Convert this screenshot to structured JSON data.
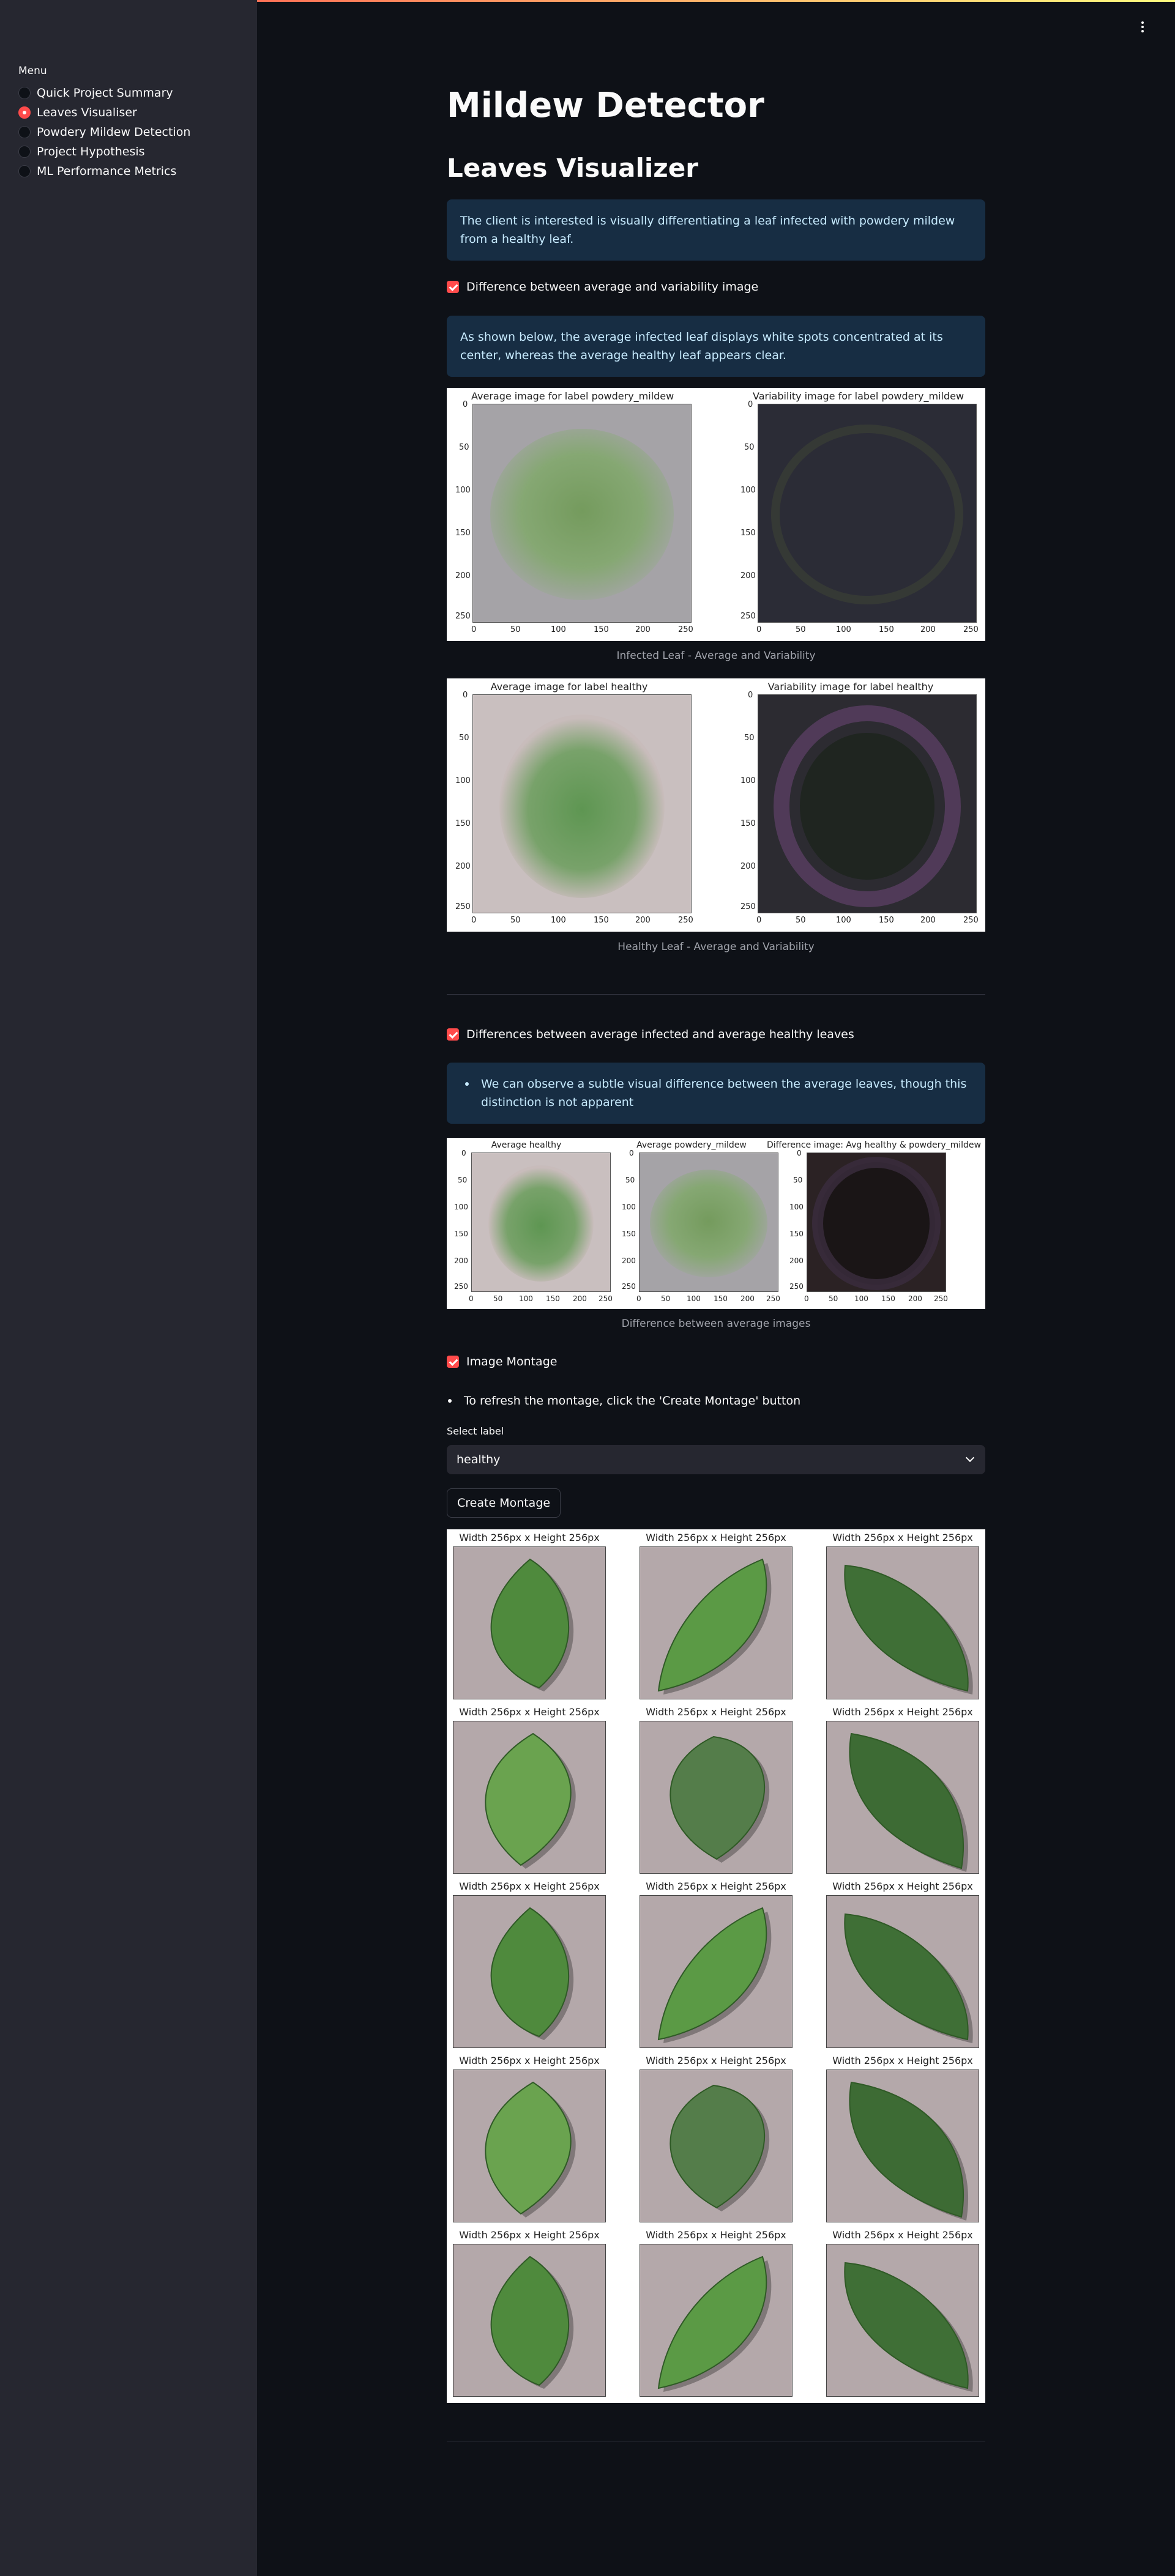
{
  "sidebar": {
    "menu_title": "Menu",
    "items": [
      {
        "label": "Quick Project Summary",
        "selected": false
      },
      {
        "label": "Leaves Visualiser",
        "selected": true
      },
      {
        "label": "Powdery Mildew Detection",
        "selected": false
      },
      {
        "label": "Project Hypothesis",
        "selected": false
      },
      {
        "label": "ML Performance Metrics",
        "selected": false
      }
    ]
  },
  "colors": {
    "accent": "#ff4b4b",
    "info_bg": "#172d43",
    "info_text": "#c7ebff",
    "background": "#0e1117",
    "sidebar_bg": "#262730"
  },
  "page": {
    "title": "Mildew Detector",
    "subtitle": "Leaves Visualizer",
    "intro_info": "The client is interested is visually differentiating a leaf infected with powdery mildew from a healthy leaf."
  },
  "section1": {
    "checkbox_label": "Difference between average and variability image",
    "info": "As shown below, the average infected leaf displays white spots concentrated at its center, whereas the average healthy leaf appears clear.",
    "fig_infected": {
      "left_title": "Average image for label powdery_mildew",
      "right_title": "Variability image for label powdery_mildew",
      "caption": "Infected Leaf - Average and Variability"
    },
    "fig_healthy": {
      "left_title": "Average image for label healthy",
      "right_title": "Variability image for label healthy",
      "caption": "Healthy Leaf - Average and Variability"
    },
    "y_ticks": [
      "0",
      "50",
      "100",
      "150",
      "200",
      "250"
    ],
    "x_ticks": [
      "0",
      "50",
      "100",
      "150",
      "200",
      "250"
    ]
  },
  "section2": {
    "checkbox_label": "Differences between average infected and average healthy leaves",
    "bullet": "We can observe a subtle visual difference between the average leaves, though this distinction is not apparent",
    "titles": [
      "Average healthy",
      "Average powdery_mildew",
      "Difference image: Avg healthy & powdery_mildew"
    ],
    "caption": "Difference between average images",
    "y_ticks": [
      "0",
      "50",
      "100",
      "150",
      "200",
      "250"
    ],
    "x_ticks": [
      "0",
      "50",
      "100",
      "150",
      "200",
      "250"
    ]
  },
  "section3": {
    "checkbox_label": "Image Montage",
    "bullet": "To refresh the montage, click the 'Create Montage' button",
    "select_label": "Select label",
    "select_value": "healthy",
    "button_label": "Create Montage",
    "cell_title": "Width 256px x Height 256px",
    "rows": 5,
    "cols": 3
  }
}
